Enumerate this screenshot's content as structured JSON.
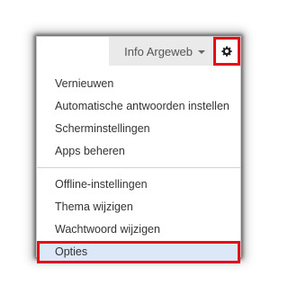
{
  "header": {
    "account_name": "Info Argeweb",
    "settings_icon": "gear-icon",
    "dropdown_icon": "chevron-down-icon"
  },
  "menu": {
    "group1": [
      {
        "label": "Vernieuwen"
      },
      {
        "label": "Automatische antwoorden instellen"
      },
      {
        "label": "Scherminstellingen"
      },
      {
        "label": "Apps beheren"
      }
    ],
    "group2": [
      {
        "label": "Offline-instellingen"
      },
      {
        "label": "Thema wijzigen"
      },
      {
        "label": "Wachtwoord wijzigen"
      },
      {
        "label": "Opties",
        "selected": true
      }
    ]
  },
  "colors": {
    "highlight_outline": "#e3101c",
    "selected_background": "#dce7f7",
    "topbar_background": "#eaeaea"
  }
}
